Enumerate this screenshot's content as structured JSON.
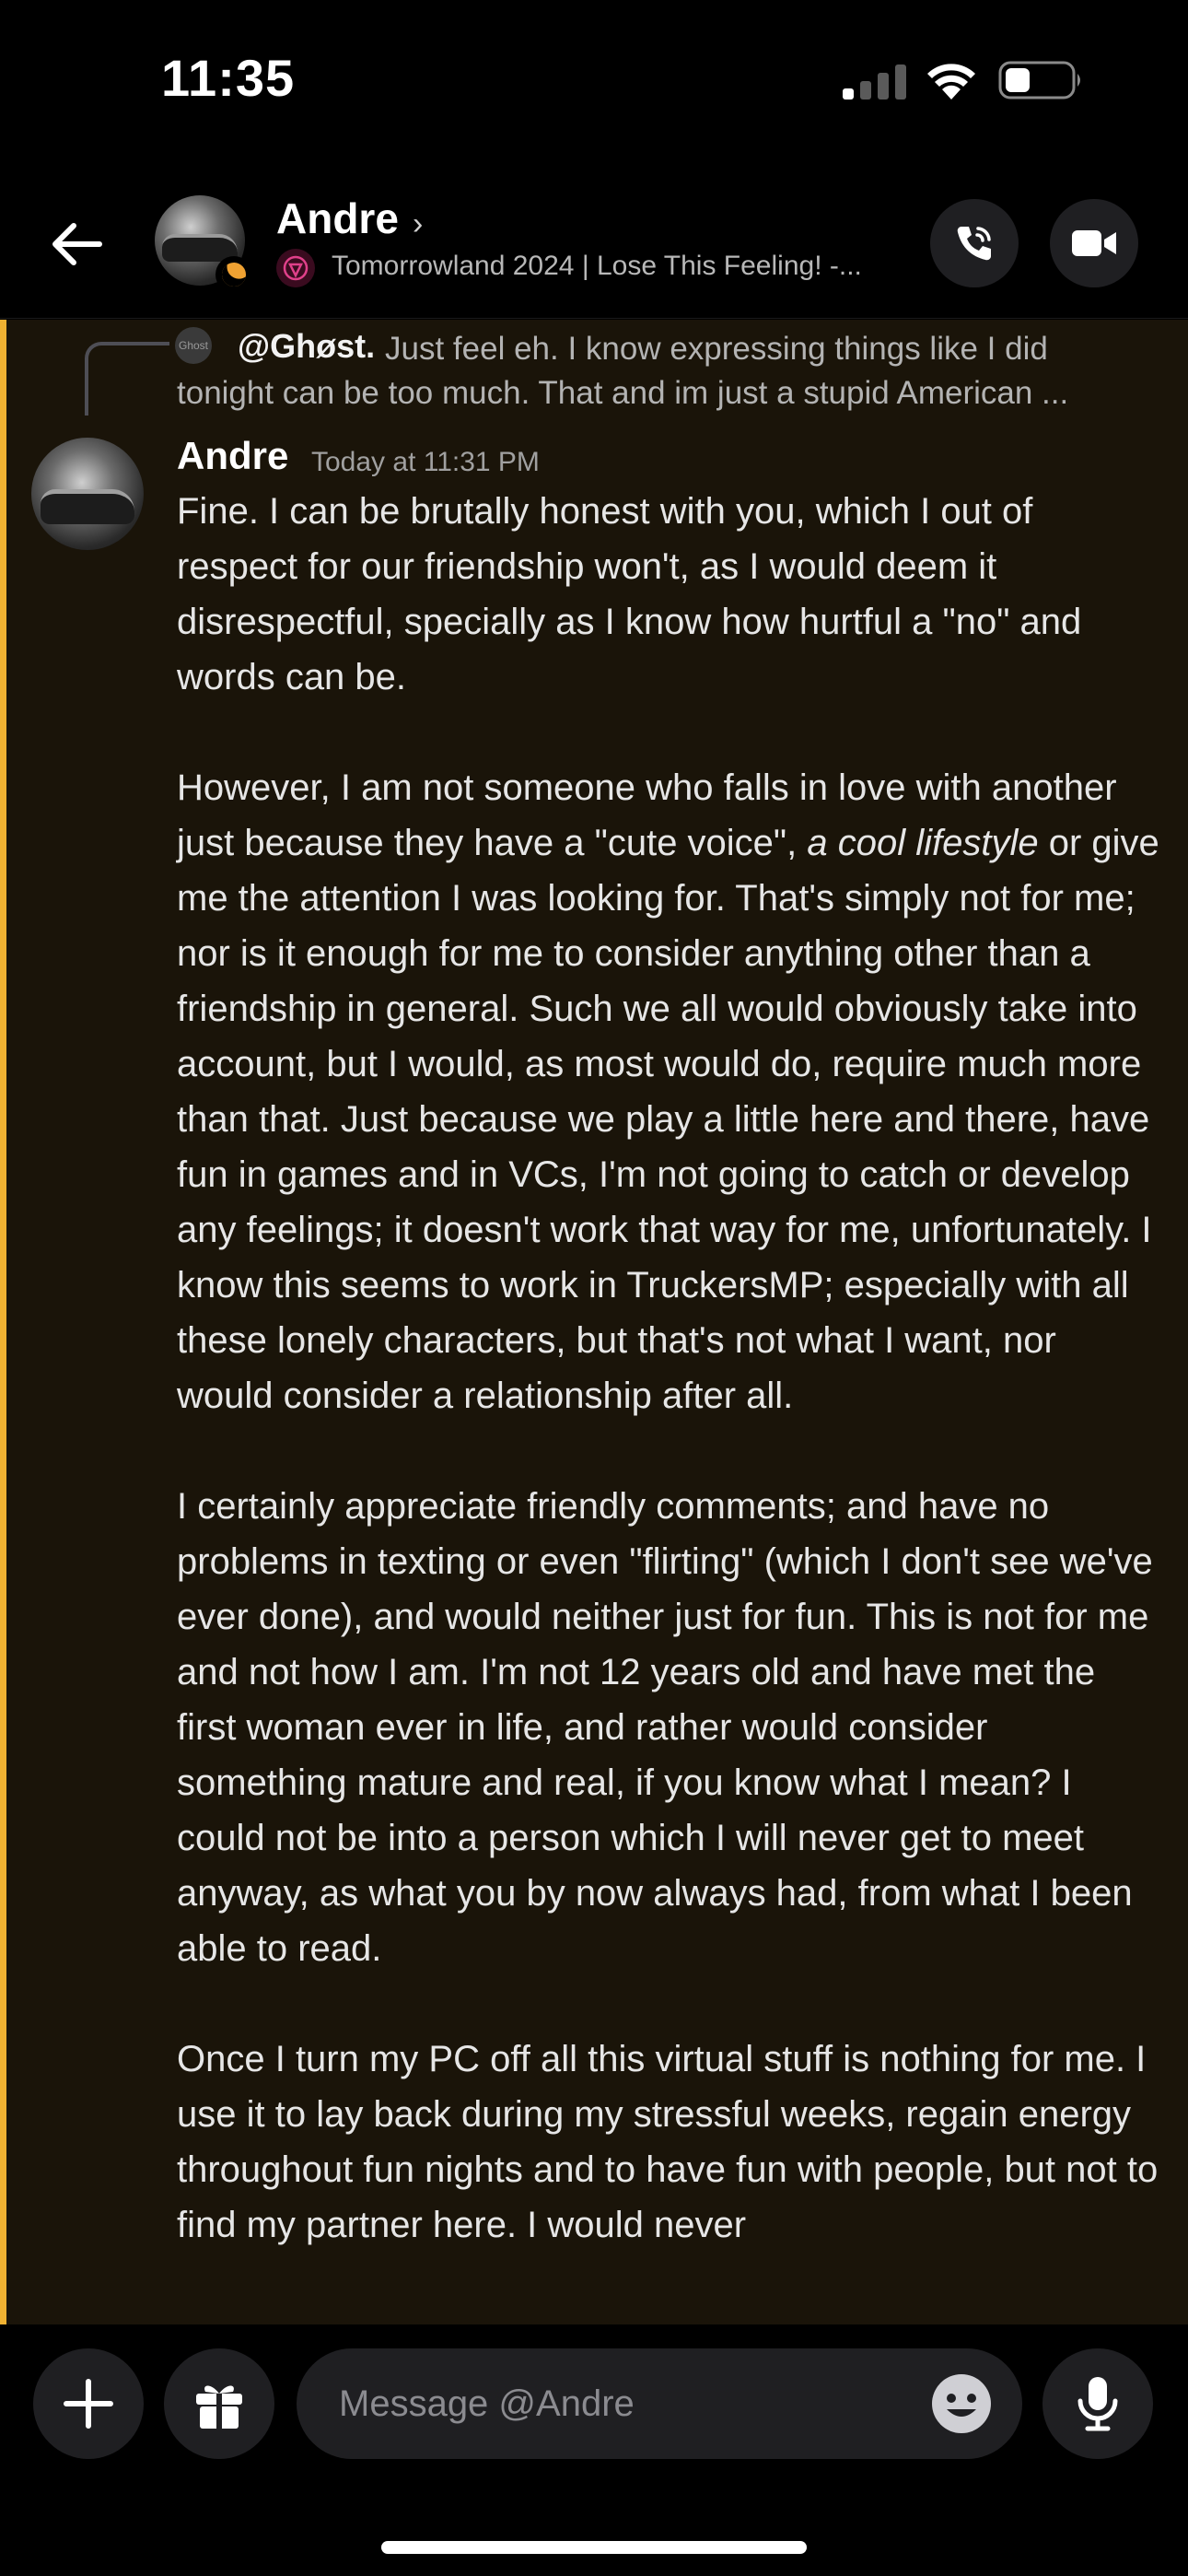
{
  "status_bar": {
    "time": "11:35",
    "signal_icon": "cellular-signal-icon",
    "wifi_icon": "wifi-icon",
    "battery_icon": "battery-icon"
  },
  "header": {
    "contact_name": "Andre",
    "chevron": "›",
    "activity": "Tomorrowland 2024 | Lose This Feeling! -...",
    "back_icon": "arrow-left-icon",
    "call_icon": "phone-call-icon",
    "video_icon": "video-camera-icon",
    "status_color": "#f0a232"
  },
  "chat": {
    "background": "#1a1409",
    "mention_color": "#f0b232",
    "reply": {
      "avatar_label": "Ghost",
      "author": "@Ghøst.",
      "text_line1": "Just feel eh. I know expressing things like I did",
      "text_line2": "tonight can be too much. That and im just a stupid American ..."
    },
    "message": {
      "author": "Andre",
      "timestamp": "Today at 11:31 PM",
      "p1": "Fine. I can be brutally honest with you, which I out of respect for our friendship won't, as I would deem it disrespectful, specially as I know how hurtful a \"no\" and words can be.",
      "p2_before": "However, I am not someone who falls in love with another just because they have a \"cute voice\", ",
      "p2_italic": "a cool lifestyle",
      "p2_after": " or give me the attention I was looking for. That's simply not for me; nor is it enough for me to consider anything other than a friendship in general. Such we all would obviously take into account, but I would, as most would do, require much more than that. Just because we play a little here and there, have fun in games and in VCs, I'm not going to catch or develop any feelings; it doesn't work that way for me, unfortunately. I know this seems to work in TruckersMP; especially with all these lonely characters, but that's not what I want, nor would consider a relationship after all.",
      "p3": "I certainly appreciate friendly comments; and have no problems in texting or even \"flirting\" (which I don't see we've ever done), and would neither just for fun. This is not for me and not how I am. I'm not 12 years old and have met the first woman ever in life, and rather would consider something mature and real, if you know what I mean? I could not be into a person which I will never get to meet anyway, as what you by now always had, from what I been able to read.",
      "p4": "Once I turn my PC off all this virtual stuff is nothing for me. I use it to lay back during my stressful weeks, regain energy throughout fun nights and to have fun with people, but not to find my partner here. I would never"
    }
  },
  "composer": {
    "placeholder": "Message @Andre",
    "plus_icon": "plus-icon",
    "gift_icon": "gift-icon",
    "emoji_icon": "emoji-icon",
    "mic_icon": "microphone-icon"
  }
}
